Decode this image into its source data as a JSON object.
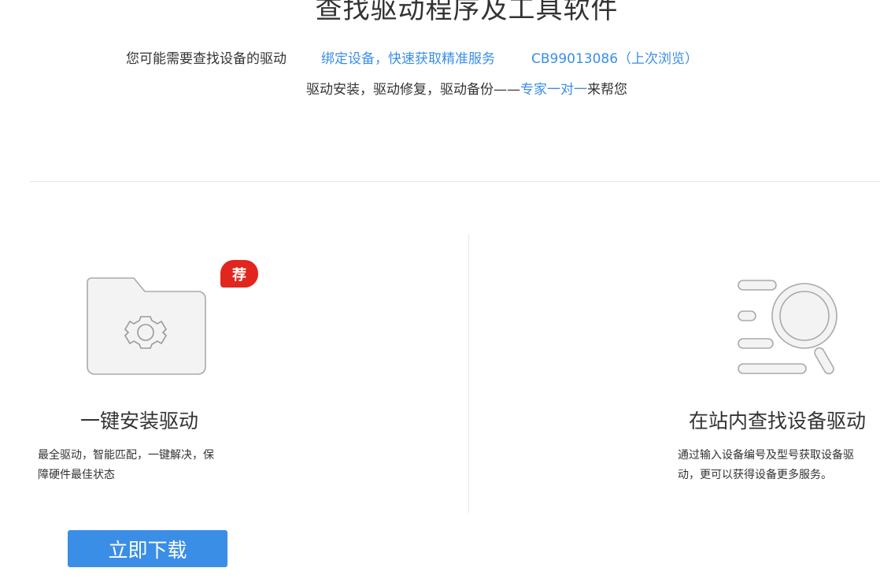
{
  "header": {
    "title": "查找驱动程序及工具软件"
  },
  "hints": {
    "prompt": "您可能需要查找设备的驱动",
    "bind_link": "绑定设备，快速获取精准服务",
    "device_link": "CB99013086（上次浏览）"
  },
  "service": {
    "prefix": "驱动安装，驱动修复，驱动备份——",
    "expert_link": "专家一对一",
    "suffix": "来帮您"
  },
  "left_card": {
    "badge": "荐",
    "title": "一键安装驱动",
    "desc_line1": "最全驱动，智能匹配，一键解决，保",
    "desc_line2": "障硬件最佳状态",
    "button_label": "立即下载",
    "icon": "folder-gear-icon"
  },
  "right_card": {
    "title": "在站内查找设备驱动",
    "desc_line1": "通过输入设备编号及型号获取设备驱",
    "desc_line2": "动，更可以获得设备更多服务。",
    "icon": "list-search-icon"
  },
  "colors": {
    "link": "#3a8ee6",
    "button": "#3a8ee6",
    "badge": "#e0261e",
    "text": "#333333",
    "divider": "#e5e5e5",
    "icon_stroke": "#aaaaaa"
  }
}
